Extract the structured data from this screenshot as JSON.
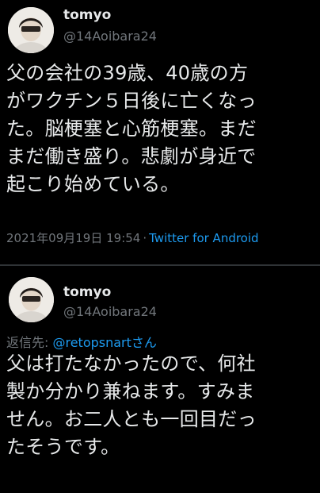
{
  "tweets": [
    {
      "display_name": "tomyo",
      "handle": "@14Aoibara24",
      "body_lines": [
        "父の会社の39歳、40歳の方",
        "がワクチン５日後に亡くなっ",
        "た。脳梗塞と心筋梗塞。まだ",
        "まだ働き盛り。悲劇が身近で",
        "起こり始めている。"
      ],
      "date": "2021年09月19日 19:54",
      "separator": "·",
      "source": "Twitter for Android"
    },
    {
      "display_name": "tomyo",
      "handle": "@14Aoibara24",
      "reply_label": "返信先: ",
      "reply_mention": "@retopsnart",
      "reply_suffix": "さん",
      "body_lines": [
        "父は打たなかったので、何社",
        "製か分かり兼ねます。すみま",
        "せん。お二人とも一回目だっ",
        "たそうです。"
      ]
    }
  ],
  "colors": {
    "background": "#000000",
    "text_primary": "#e7e9ea",
    "text_secondary": "#71767b",
    "link": "#1d9bf0",
    "divider": "#2f3336"
  },
  "icons": {
    "avatar": "profile-photo"
  }
}
